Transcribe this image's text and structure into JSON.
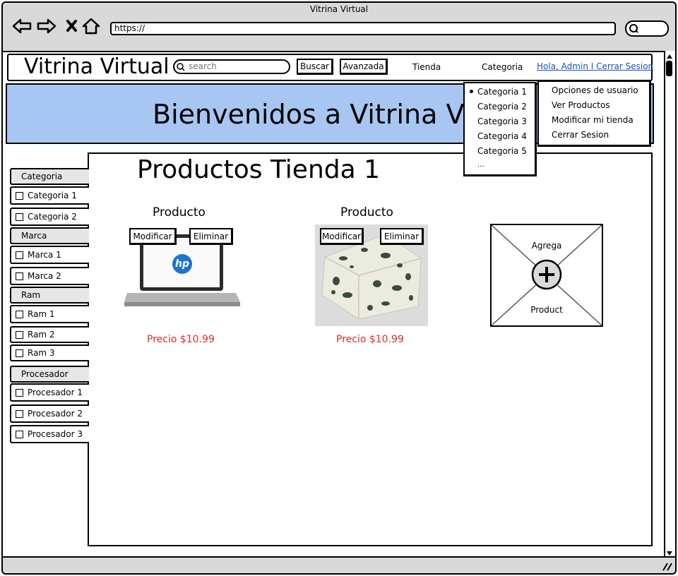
{
  "window": {
    "title": "Vitrina Virtual",
    "url": "https://"
  },
  "header": {
    "logo": "Vitrina Virtual",
    "search_placeholder": "search",
    "buscar": "Buscar",
    "avanzada": "Avanzada",
    "tienda": "Tienda",
    "categoria": "Categoria",
    "user_link": "Hola, Admin I Cerrar Sesion"
  },
  "banner": {
    "title": "Bienvenidos a Vitrina Virtual"
  },
  "category_menu": [
    "Categoria 1",
    "Categoria 2",
    "Categoria 3",
    "Categoria 4",
    "Categoria 5",
    "..."
  ],
  "user_menu": [
    "Opciones de usuario",
    "Ver Productos",
    "Modificar mi tienda",
    "Cerrar Sesion"
  ],
  "sidebar": {
    "categoria": {
      "label": "Categoria",
      "items": [
        "Categoria 1",
        "Categoria 2"
      ]
    },
    "marca": {
      "label": "Marca",
      "items": [
        "Marca 1",
        "Marca 2"
      ]
    },
    "ram": {
      "label": "Ram",
      "items": [
        "Ram 1",
        "Ram 2",
        "Ram 3"
      ]
    },
    "procesador": {
      "label": "Procesador",
      "items": [
        "Procesador 1",
        "Procesador 2",
        "Procesador 3"
      ]
    }
  },
  "main": {
    "title": "Productos Tienda 1",
    "products": [
      {
        "name": "Producto",
        "modificar": "Modificar",
        "eliminar": "Eliminar",
        "price": "Precio $10.99",
        "brand_logo": "hp"
      },
      {
        "name": "Producto",
        "modificar": "Modificar",
        "eliminar": "Eliminar",
        "price": "Precio $10.99"
      }
    ],
    "add_product": {
      "top": "Agrega",
      "bottom": "Product"
    }
  },
  "colors": {
    "banner": "#a8c6f2",
    "price": "#d32f2f",
    "link": "#1a56b0"
  }
}
